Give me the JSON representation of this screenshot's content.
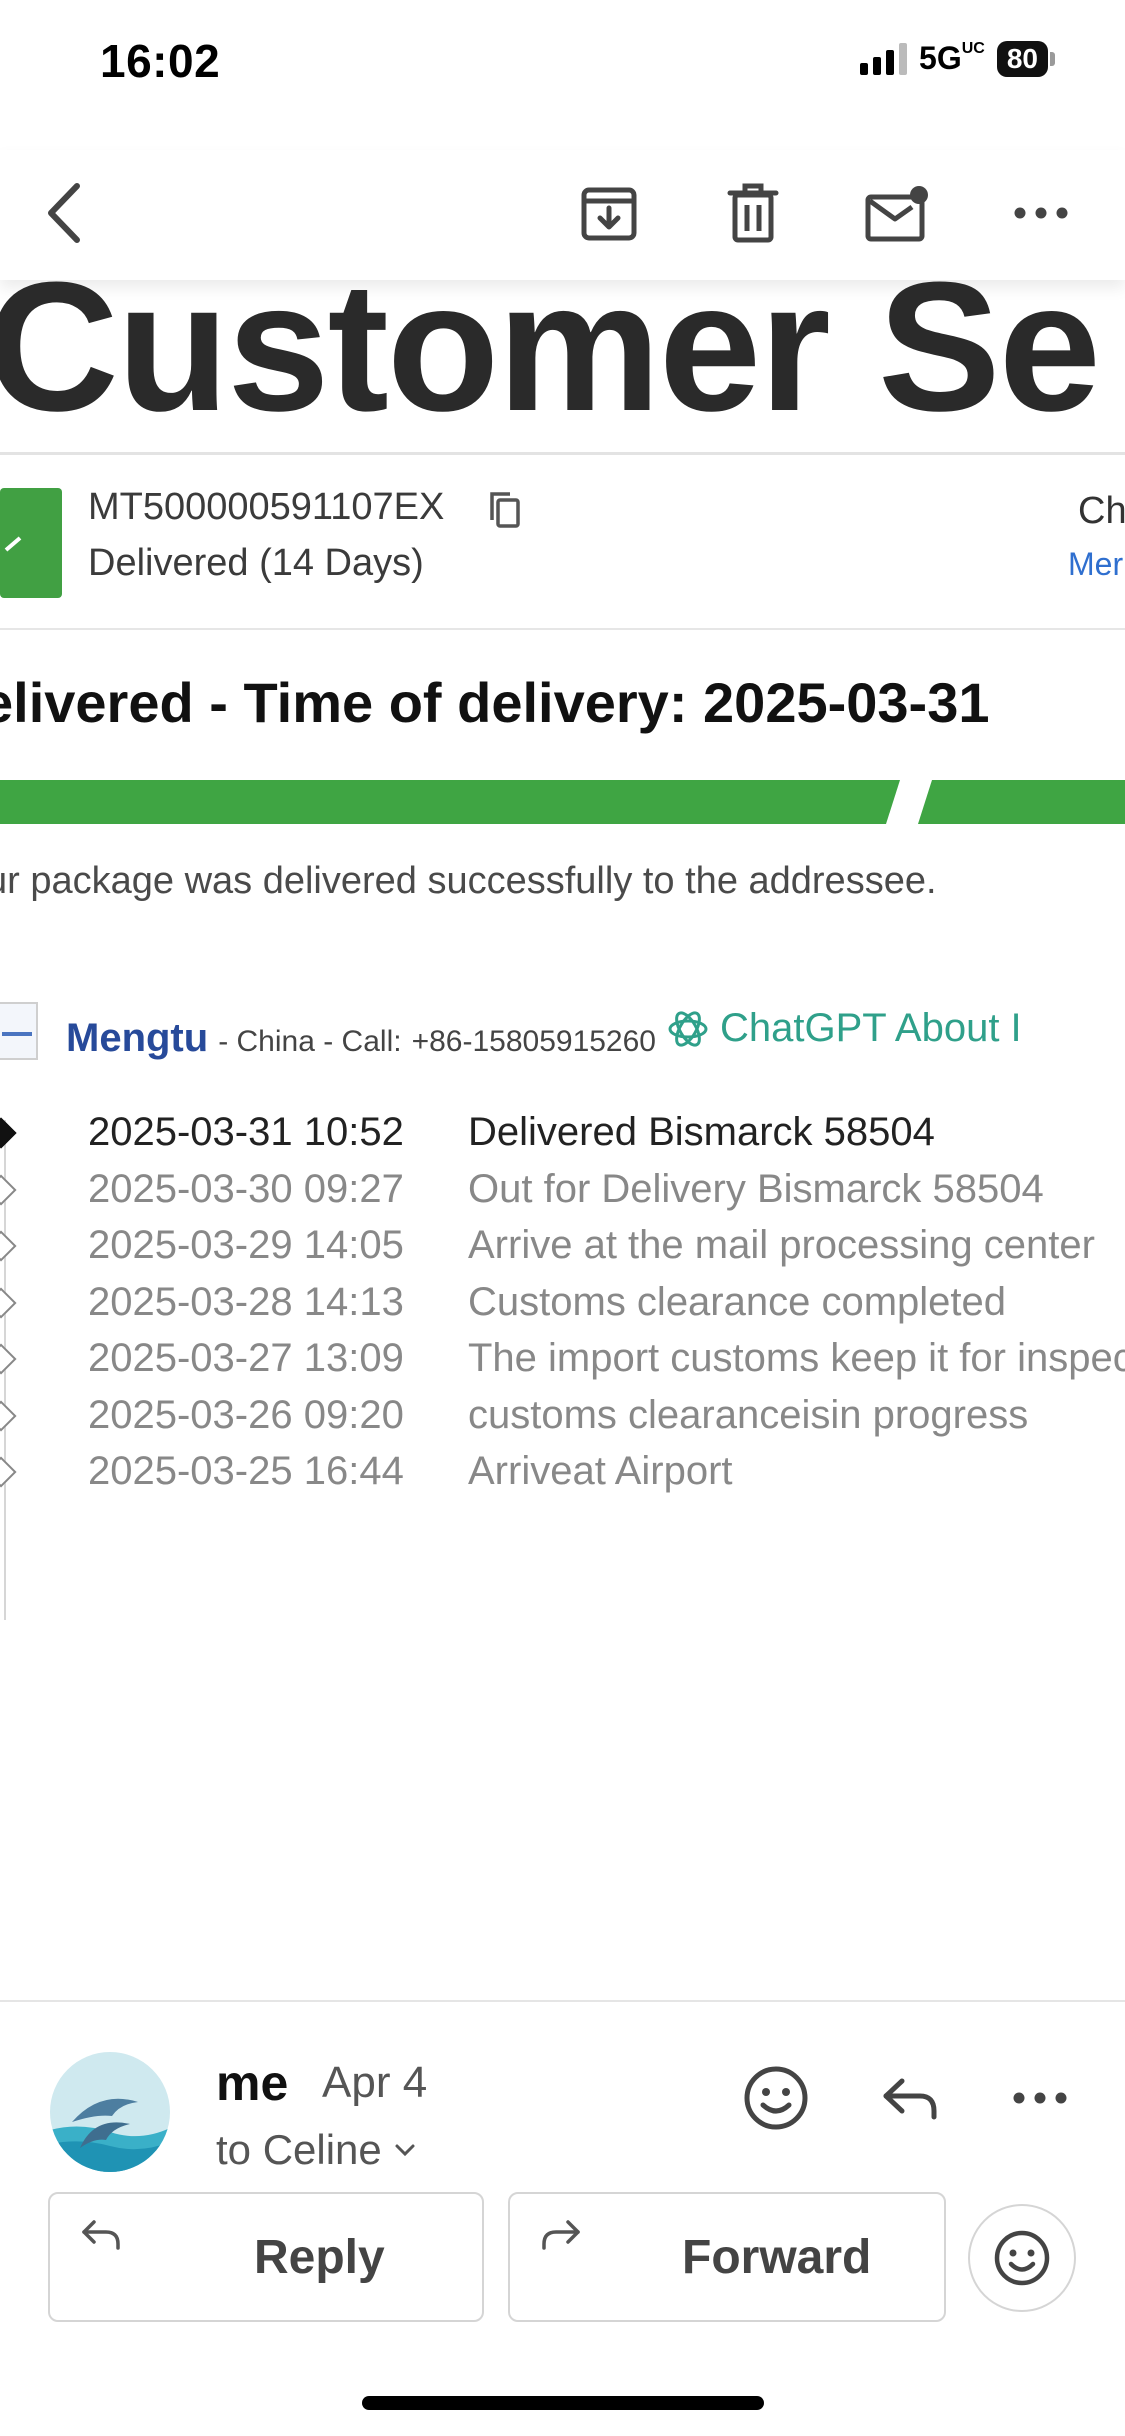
{
  "status_bar": {
    "time": "16:02",
    "network": "5G",
    "network_superscript": "UC",
    "battery": "80"
  },
  "toolbar": {
    "back": "chevron-left-icon",
    "archive": "archive-download-icon",
    "delete": "trash-icon",
    "mark_unread": "mail-unread-icon",
    "more": "more-horizontal-icon"
  },
  "email_content": {
    "big_title": "Customer Se",
    "tracking_number": "MT500000591107EX",
    "delivered_days": "Delivered (14 Days)",
    "right_top": "Ch",
    "right_link": "Mer",
    "headline": "elivered - Time of delivery:  2025-03-31",
    "subtext": "ur package was delivered successfully to the addressee.",
    "carrier": {
      "name": "Mengtu",
      "info": "- China - Call:",
      "phone": "+86-15805915260",
      "link": "ChatGPT About I"
    },
    "events": [
      {
        "datetime": "2025-03-31 10:52",
        "description": "Delivered Bismarck 58504"
      },
      {
        "datetime": "2025-03-30 09:27",
        "description": "Out for Delivery Bismarck 58504"
      },
      {
        "datetime": "2025-03-29 14:05",
        "description": "Arrive at the mail processing center"
      },
      {
        "datetime": "2025-03-28 14:13",
        "description": "Customs clearance completed"
      },
      {
        "datetime": "2025-03-27 13:09",
        "description": "The import customs keep it for inspec"
      },
      {
        "datetime": "2025-03-26 09:20",
        "description": "customs clearanceisin progress"
      },
      {
        "datetime": "2025-03-25 16:44",
        "description": "Arriveat Airport"
      }
    ]
  },
  "sender": {
    "name": "me",
    "date": "Apr 4",
    "to": "to Celine"
  },
  "actions": {
    "reply": "Reply",
    "forward": "Forward"
  },
  "colors": {
    "green": "#3fa543",
    "carrier_blue": "#274a9a",
    "link_teal": "#2fa08a"
  }
}
